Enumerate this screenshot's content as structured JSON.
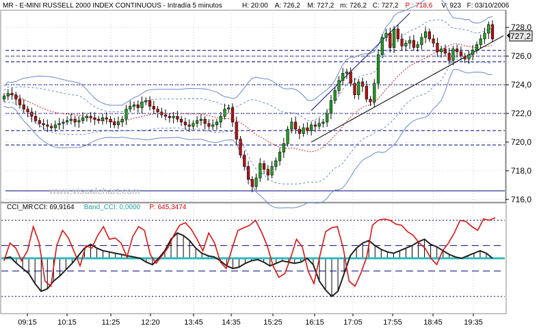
{
  "header": {
    "instrument": "MR - E-MINI RUSSELL 2000 INDEX CONTINUOUS - Intradía 5 minutos",
    "fields": [
      {
        "key": "H:",
        "value": "20:00"
      },
      {
        "key": "A:",
        "value": "726,2"
      },
      {
        "key": "M:",
        "value": "727,2"
      },
      {
        "key": "m:",
        "value": "726,2"
      },
      {
        "key": "C:",
        "value": "727,2"
      },
      {
        "key": "P :",
        "value": "718,6",
        "color": "#d00000"
      },
      {
        "key": "V:",
        "value": "923"
      },
      {
        "key": "F:",
        "value": "03/10/2006"
      }
    ]
  },
  "watermark": "www.visualchart.com",
  "price_panel": {
    "last_price_label": "727,2",
    "y_ticks": [
      "728,0",
      "726,0",
      "724,0",
      "722,0",
      "720,0",
      "718,0",
      "716,0"
    ],
    "colors": {
      "up": "#20a020",
      "down": "#c01010",
      "band": "#6688cc",
      "midline": "#cc2222",
      "levels": "#000080",
      "trend": "#000000"
    }
  },
  "cci_panel": {
    "legend": [
      {
        "text": "CCI_MR",
        "color": "#000000"
      },
      {
        "text": "CCI: 69,9164",
        "color": "#000000"
      },
      {
        "text": "Band_CCI: 0,0000",
        "color": "#20a0a0"
      },
      {
        "text": "P: 645,3474",
        "color": "#d00000"
      }
    ],
    "colors": {
      "cci": "#202020",
      "fast": "#dd1111",
      "zero": "#30b8b8",
      "bands": "#000080"
    }
  },
  "x_ticks": [
    "09:15",
    "10:15",
    "11:25",
    "12:20",
    "13:45",
    "14:35",
    "15:25",
    "16:15",
    "17:05",
    "17:55",
    "18:45",
    "19:35"
  ],
  "chart_data": {
    "type": "candlestick",
    "title": "MR - E-MINI RUSSELL 2000 INDEX CONTINUOUS - Intradía 5 minutos",
    "ylim": [
      715.8,
      729.2
    ],
    "price_levels": [
      726.4,
      726.0,
      725.6,
      724.0,
      722.0,
      720.8,
      719.8,
      716.6
    ],
    "x_categories": [
      "09:15",
      "10:15",
      "11:25",
      "12:20",
      "13:45",
      "14:35",
      "15:25",
      "16:15",
      "17:05",
      "17:55",
      "18:45",
      "19:35"
    ],
    "close": [
      723.2,
      723.4,
      723.3,
      723.0,
      722.6,
      722.3,
      722.1,
      721.8,
      721.5,
      721.3,
      721.2,
      721.1,
      721.0,
      721.2,
      721.3,
      721.4,
      721.5,
      721.6,
      721.4,
      721.5,
      721.7,
      721.8,
      721.7,
      721.6,
      721.5,
      721.7,
      721.6,
      721.4,
      721.2,
      721.4,
      721.6,
      722.3,
      722.5,
      722.6,
      722.4,
      722.8,
      722.9,
      722.5,
      722.3,
      722.1,
      721.9,
      721.8,
      721.7,
      721.8,
      721.6,
      721.4,
      721.2,
      721.1,
      721.3,
      721.5,
      721.6,
      721.3,
      721.1,
      721.2,
      721.4,
      721.8,
      722.3,
      722.4,
      721.4,
      720.2,
      719.1,
      718.3,
      717.4,
      716.9,
      717.5,
      718.5,
      718.1,
      717.7,
      718.3,
      718.7,
      719.3,
      719.9,
      720.9,
      721.4,
      720.9,
      720.6,
      721.0,
      720.8,
      721.2,
      721.1,
      721.3,
      721.4,
      722.0,
      722.9,
      723.6,
      724.3,
      724.8,
      724.9,
      724.1,
      723.3,
      724.2,
      723.9,
      723.0,
      722.8,
      724.1,
      726.1,
      727.3,
      727.6,
      726.6,
      727.9,
      727.2,
      726.7,
      726.9,
      727.1,
      726.6,
      726.8,
      727.3,
      727.7,
      727.2,
      726.9,
      726.3,
      726.5,
      726.2,
      725.7,
      726.5,
      726.3,
      726.0,
      725.8,
      726.1,
      726.4,
      726.8,
      727.2,
      727.6,
      728.2,
      727.2
    ],
    "cci": [
      0,
      10,
      -40,
      -80,
      -120,
      -200,
      -260,
      -240,
      -180,
      -140,
      -90,
      -40,
      20,
      80,
      110,
      80,
      60,
      50,
      40,
      30,
      20,
      10,
      0,
      -30,
      -50,
      0,
      60,
      150,
      200,
      180,
      140,
      80,
      40,
      20,
      10,
      -20,
      -60,
      -80,
      -70,
      -40,
      -20,
      -10,
      -30,
      -60,
      -40,
      -20,
      -30,
      -40,
      -30,
      0,
      -50,
      -180,
      -250,
      -300,
      -260,
      -120,
      20,
      80,
      120,
      140,
      100,
      70,
      50,
      40,
      60,
      80,
      100,
      130,
      150,
      110,
      90,
      60,
      30,
      10,
      0,
      20,
      40,
      60,
      40,
      0
    ],
    "fast": [
      -20,
      120,
      80,
      -20,
      60,
      250,
      120,
      -180,
      -220,
      100,
      220,
      160,
      50,
      -60,
      100,
      80,
      180,
      250,
      150,
      160,
      120,
      10,
      170,
      250,
      220,
      30,
      -40,
      20,
      80,
      180,
      260,
      280,
      230,
      150,
      60,
      200,
      120,
      -30,
      -80,
      80,
      220,
      240,
      260,
      300,
      210,
      100,
      -60,
      -150,
      -120,
      0,
      150,
      90,
      -100,
      -200,
      20,
      210,
      240,
      250,
      80,
      -180,
      -220,
      -120,
      10,
      260,
      300,
      310,
      300,
      270,
      260,
      210,
      180,
      120,
      80,
      0,
      -50,
      60,
      120,
      200,
      300,
      290,
      250,
      220,
      310,
      300,
      320
    ]
  }
}
